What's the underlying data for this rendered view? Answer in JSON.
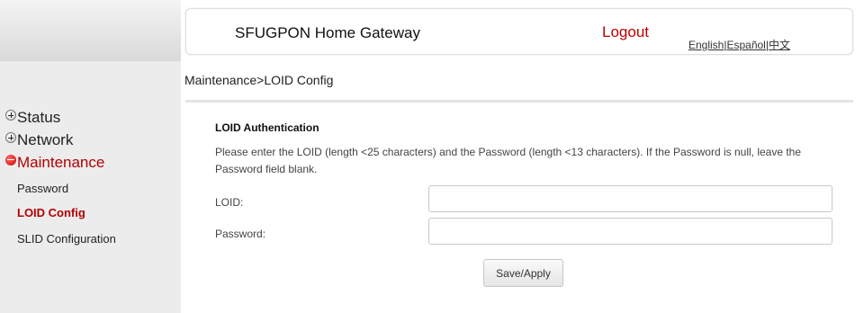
{
  "header": {
    "title": "SFUGPON Home Gateway",
    "logout_label": "Logout",
    "languages": [
      "English",
      "Español",
      "中文"
    ],
    "language_separator": "|"
  },
  "breadcrumb": "Maintenance>LOID Config",
  "sidebar": {
    "groups": [
      {
        "label": "Status",
        "expanded": false,
        "icon": "plus-icon"
      },
      {
        "label": "Network",
        "expanded": false,
        "icon": "plus-icon"
      },
      {
        "label": "Maintenance",
        "expanded": true,
        "icon": "minus-icon"
      }
    ],
    "items": [
      {
        "label": "Password",
        "active": false
      },
      {
        "label": "LOID Config",
        "active": true
      },
      {
        "label": "SLID Configuration",
        "active": false
      }
    ]
  },
  "form": {
    "section_title": "LOID Authentication",
    "description": "Please enter the LOID (length <25 characters) and the Password (length <13 characters). If the Password is null, leave the Password field blank.",
    "loid_label": "LOID:",
    "loid_value": "",
    "password_label": "Password:",
    "password_value": "",
    "save_label": "Save/Apply"
  },
  "colors": {
    "accent": "#b20000",
    "sidebar_bg": "#ececec"
  }
}
